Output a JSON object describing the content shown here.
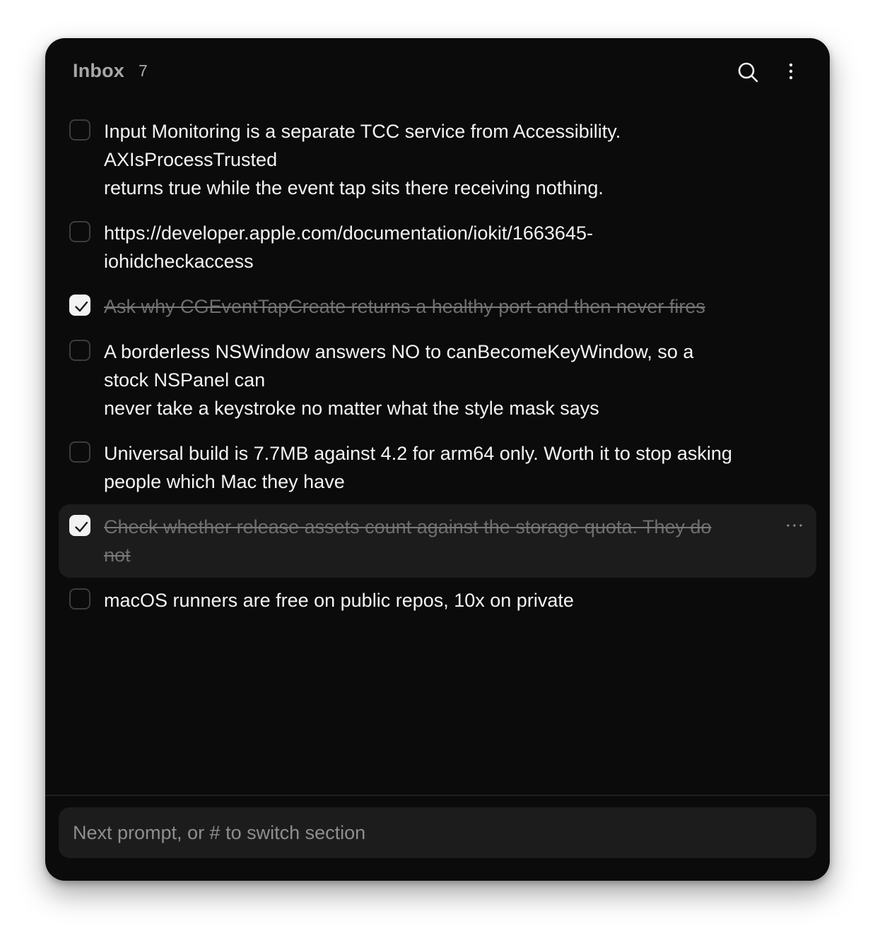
{
  "header": {
    "title": "Inbox",
    "count": "7",
    "search_icon": "search-icon",
    "more_icon": "vertical-ellipsis-icon"
  },
  "items": [
    {
      "text": "Input Monitoring is a separate TCC service from Accessibility.\nAXIsProcessTrusted\nreturns true while the event tap sits there receiving nothing.",
      "checked": false
    },
    {
      "text": "https://developer.apple.com/documentation/iokit/1663645-\niohidcheckaccess",
      "checked": false
    },
    {
      "text": "Ask why CGEventTapCreate returns a healthy port and then never fires",
      "checked": true
    },
    {
      "text": "A borderless NSWindow answers NO to canBecomeKeyWindow, so a\nstock NSPanel can\nnever take a keystroke no matter what the style mask says",
      "checked": false
    },
    {
      "text": "Universal build is 7.7MB against 4.2 for arm64 only. Worth it to stop asking\npeople which Mac they have",
      "checked": false
    },
    {
      "text": "Check whether release assets count against the storage quota. They do\nnot",
      "checked": true,
      "hovered": true
    },
    {
      "text": "macOS runners are free on public repos, 10x on private",
      "checked": false
    }
  ],
  "prompt": {
    "placeholder": "Next prompt, or # to switch section",
    "value": ""
  },
  "colors": {
    "window_bg": "#0b0b0b",
    "row_hover_bg": "#1c1c1c",
    "text": "#f4f4f4",
    "muted_text": "#6e6e6e",
    "checkbox_checked": "#f2f2f2"
  }
}
